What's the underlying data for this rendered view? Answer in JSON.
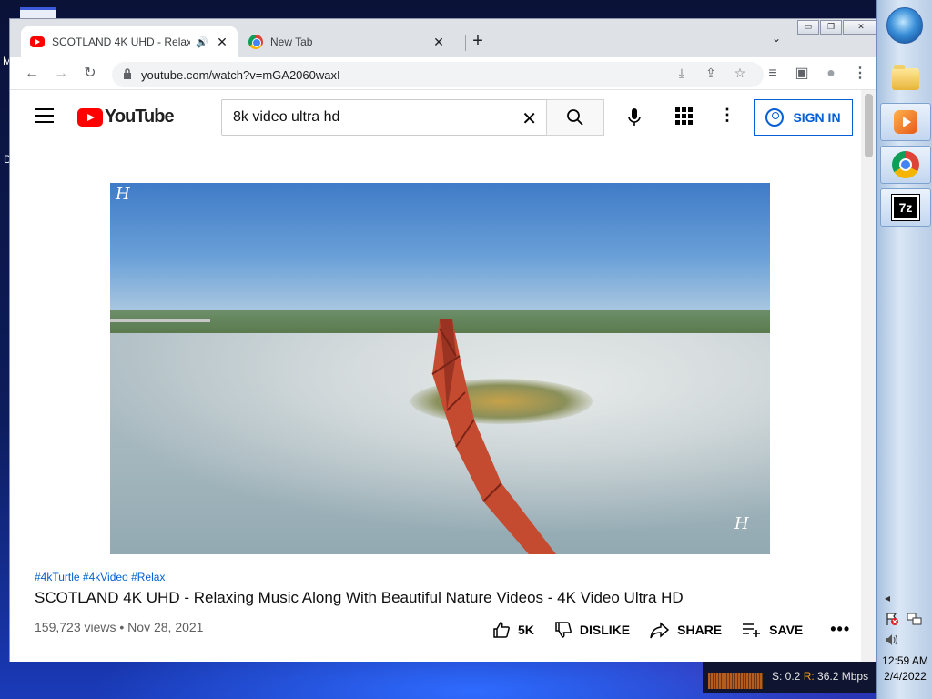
{
  "desktop": {
    "frag_m": "M",
    "frag_d": "D"
  },
  "browser": {
    "tabs": [
      {
        "title": "SCOTLAND 4K UHD - Relaxi",
        "audio": "🔊",
        "close": "✕"
      },
      {
        "title": "New Tab",
        "close": "✕"
      }
    ],
    "new_tab": "+",
    "tab_search": "⌄",
    "window_controls": {
      "minimize": "▭",
      "restore": "❐",
      "close": "✕"
    },
    "nav": {
      "back": "←",
      "forward": "→",
      "reload": "↻"
    },
    "url": "youtube.com/watch?v=mGA2060waxI",
    "omnibox_icons": {
      "install": "⤓",
      "share": "⇪",
      "bookmark": "☆"
    },
    "toolbar_icons": {
      "media": "≡",
      "sidepanel": "▣",
      "profile": "●",
      "menu": "⋮"
    }
  },
  "youtube": {
    "logo_text": "YouTube",
    "search_value": "8k video ultra hd",
    "search_clear": "✕",
    "sign_in": "SIGN IN",
    "watermark": "H",
    "hashtags": "#4kTurtle #4kVideo #Relax",
    "title": "SCOTLAND 4K UHD - Relaxing Music Along With Beautiful Nature Videos - 4K Video Ultra HD",
    "meta": "159,723 views • Nov 28, 2021",
    "actions": {
      "like_count": "5K",
      "dislike": "DISLIKE",
      "share": "SHARE",
      "save": "SAVE",
      "more": "•••"
    }
  },
  "taskbar": {
    "app_7z": "7z",
    "tray_chevron": "◂",
    "time": "12:59 AM",
    "date": "2/4/2022"
  },
  "netmon": {
    "send": "S: 0.2",
    "recv_label": "R:",
    "recv": "36.2 Mbps"
  }
}
